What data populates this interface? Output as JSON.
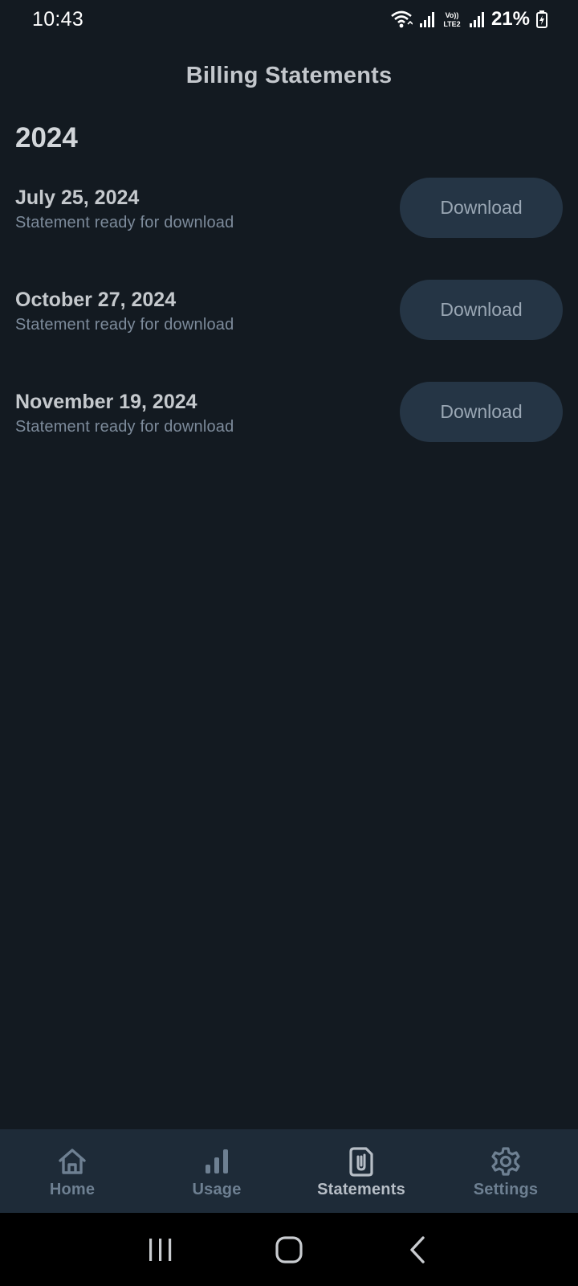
{
  "status_bar": {
    "time": "10:43",
    "battery": "21%",
    "network_label": "Vo)) LTE2"
  },
  "header": {
    "title": "Billing Statements"
  },
  "year": "2024",
  "statements": [
    {
      "date": "July 25, 2024",
      "subtitle": "Statement ready for download",
      "button": "Download"
    },
    {
      "date": "October 27, 2024",
      "subtitle": "Statement ready for download",
      "button": "Download"
    },
    {
      "date": "November 19, 2024",
      "subtitle": "Statement ready for download",
      "button": "Download"
    }
  ],
  "bottom_nav": {
    "items": [
      {
        "label": "Home",
        "icon": "home-icon",
        "active": false
      },
      {
        "label": "Usage",
        "icon": "bar-chart-icon",
        "active": false
      },
      {
        "label": "Statements",
        "icon": "paperclip-document-icon",
        "active": true
      },
      {
        "label": "Settings",
        "icon": "gear-icon",
        "active": false
      }
    ]
  },
  "colors": {
    "background": "#131a21",
    "button_bg": "#253545",
    "nav_bg": "#1e2b38",
    "active_nav": "#b7bec6",
    "inactive_nav": "#6e8092"
  }
}
